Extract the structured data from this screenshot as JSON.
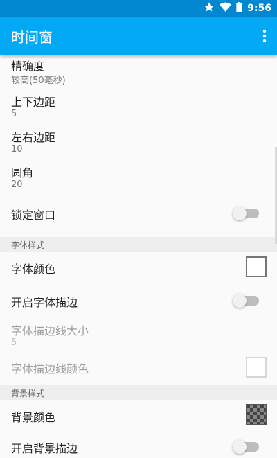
{
  "status_bar": {
    "time": "9:56",
    "icons": [
      "star-icon",
      "wifi-icon",
      "battery-icon"
    ]
  },
  "app_bar": {
    "title": "时间窗",
    "overflow_icon": "more-vert-icon",
    "color": "#03a9f4"
  },
  "prefs": {
    "precision": {
      "title": "精确度",
      "summary": "较高(50毫秒)"
    },
    "margin_vertical": {
      "title": "上下边距",
      "summary": "5"
    },
    "margin_horizontal": {
      "title": "左右边距",
      "summary": "10"
    },
    "corner": {
      "title": "圆角",
      "summary": "20"
    },
    "lock_window": {
      "title": "锁定窗口",
      "checked": false
    },
    "font_category": "字体样式",
    "font_color": {
      "title": "字体颜色",
      "color": "#ffffff"
    },
    "font_stroke": {
      "title": "开启字体描边",
      "checked": false
    },
    "stroke_size": {
      "title": "字体描边线大小",
      "summary": "5",
      "enabled": false
    },
    "stroke_color": {
      "title": "字体描边线颜色",
      "color": "#ffffff",
      "enabled": false
    },
    "bg_category": "背景样式",
    "bg_color": {
      "title": "背景颜色",
      "color": "transparent-checker"
    },
    "bg_stroke": {
      "title": "开启背景描边",
      "checked": false
    }
  }
}
